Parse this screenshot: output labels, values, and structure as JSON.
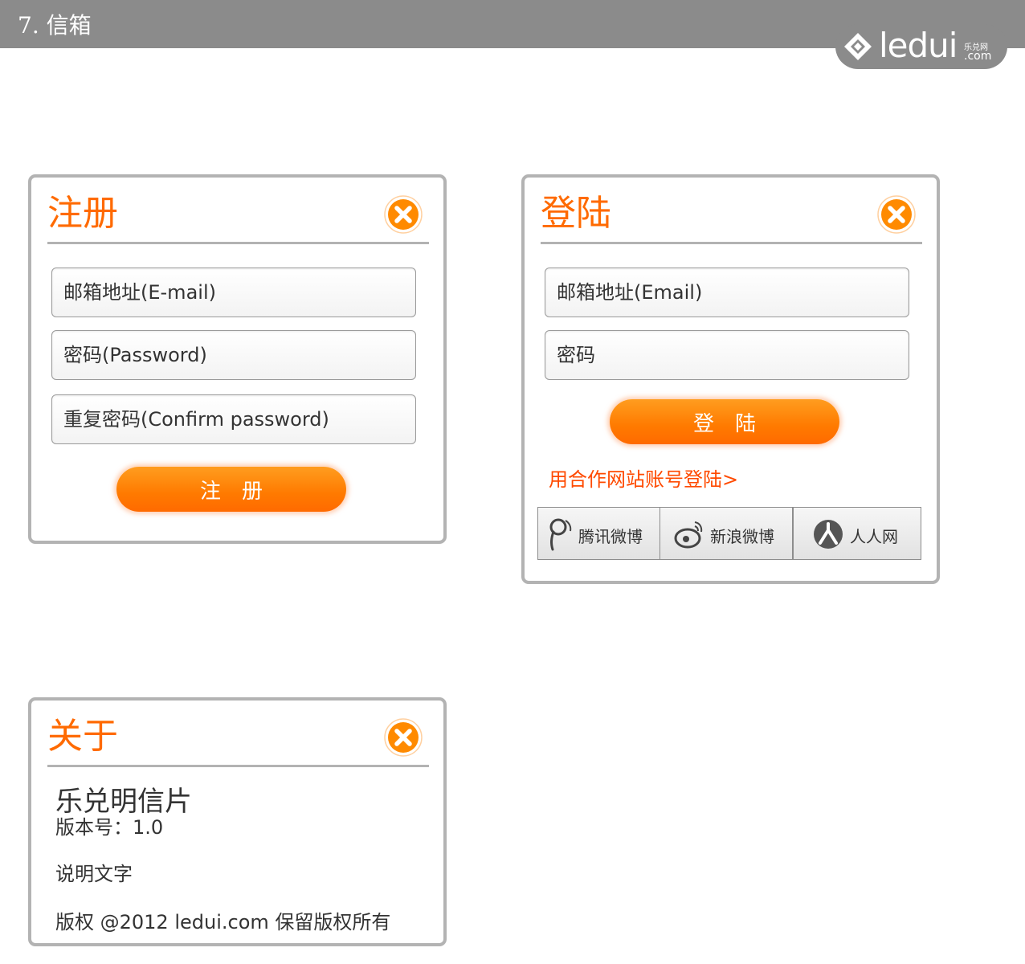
{
  "header": {
    "title": "7. 信箱",
    "logo": {
      "word": "ledui",
      "cn": "乐兑网",
      "domain": ".com"
    }
  },
  "register": {
    "title": "注册",
    "email_placeholder": "邮箱地址(E-mail)",
    "password_placeholder": "密码(Password)",
    "confirm_placeholder": "重复密码(Confirm password)",
    "submit_label": "注册"
  },
  "login": {
    "title": "登陆",
    "email_placeholder": "邮箱地址(Email)",
    "password_placeholder": "密码",
    "submit_label": "登陆",
    "partner_link": "用合作网站账号登陆>",
    "social": [
      {
        "label": "腾讯微博",
        "icon": "tencent-weibo-icon"
      },
      {
        "label": "新浪微博",
        "icon": "sina-weibo-icon"
      },
      {
        "label": "人人网",
        "icon": "renren-icon"
      }
    ]
  },
  "about": {
    "title": "关于",
    "app_name": "乐兑明信片",
    "version": "版本号：1.0",
    "description": "说明文字",
    "copyright": "版权 @2012 ledui.com 保留版权所有"
  },
  "colors": {
    "accent": "#ff6a00",
    "header_bg": "#8b8b8b",
    "panel_border": "#b3b3b3"
  }
}
